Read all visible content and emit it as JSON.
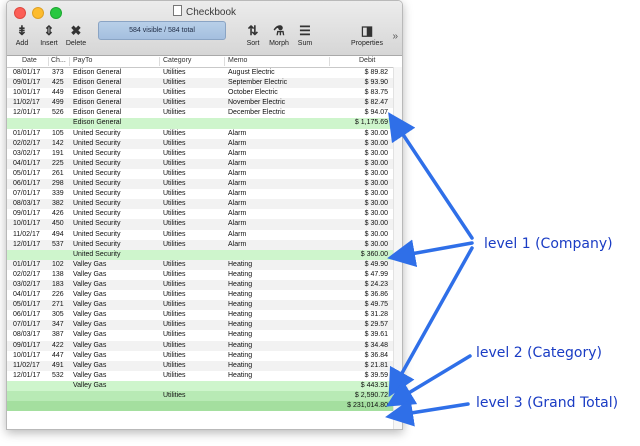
{
  "window": {
    "title": "Checkbook"
  },
  "toolbar": {
    "add": "Add",
    "insert": "Insert",
    "delete": "Delete",
    "status": "584 visible / 584 total",
    "sort": "Sort",
    "morph": "Morph",
    "sum": "Sum",
    "properties": "Properties"
  },
  "columns": {
    "date": "Date",
    "check": "Ch...",
    "payto": "PayTo",
    "category": "Category",
    "memo": "Memo",
    "debit": "Debit"
  },
  "rows": [
    {
      "type": "data",
      "date": "08/01/17",
      "check": "373",
      "payto": "Edison General",
      "category": "Utilities",
      "memo": "August Electric",
      "debit": "$ 89.82"
    },
    {
      "type": "data",
      "date": "09/01/17",
      "check": "425",
      "payto": "Edison General",
      "category": "Utilities",
      "memo": "September Electric",
      "debit": "$ 93.90"
    },
    {
      "type": "data",
      "date": "10/01/17",
      "check": "449",
      "payto": "Edison General",
      "category": "Utilities",
      "memo": "October Electric",
      "debit": "$ 83.75"
    },
    {
      "type": "data",
      "date": "11/02/17",
      "check": "499",
      "payto": "Edison General",
      "category": "Utilities",
      "memo": "November Electric",
      "debit": "$ 82.47"
    },
    {
      "type": "data",
      "date": "12/01/17",
      "check": "526",
      "payto": "Edison General",
      "category": "Utilities",
      "memo": "December Electric",
      "debit": "$ 94.07"
    },
    {
      "type": "sub",
      "date": "",
      "check": "",
      "payto": "Edison General",
      "category": "",
      "memo": "",
      "debit": "$ 1,175.69"
    },
    {
      "type": "data",
      "date": "01/01/17",
      "check": "105",
      "payto": "United Security",
      "category": "Utilities",
      "memo": "Alarm",
      "debit": "$ 30.00"
    },
    {
      "type": "data",
      "date": "02/02/17",
      "check": "142",
      "payto": "United Security",
      "category": "Utilities",
      "memo": "Alarm",
      "debit": "$ 30.00"
    },
    {
      "type": "data",
      "date": "03/02/17",
      "check": "191",
      "payto": "United Security",
      "category": "Utilities",
      "memo": "Alarm",
      "debit": "$ 30.00"
    },
    {
      "type": "data",
      "date": "04/01/17",
      "check": "225",
      "payto": "United Security",
      "category": "Utilities",
      "memo": "Alarm",
      "debit": "$ 30.00"
    },
    {
      "type": "data",
      "date": "05/01/17",
      "check": "261",
      "payto": "United Security",
      "category": "Utilities",
      "memo": "Alarm",
      "debit": "$ 30.00"
    },
    {
      "type": "data",
      "date": "06/01/17",
      "check": "298",
      "payto": "United Security",
      "category": "Utilities",
      "memo": "Alarm",
      "debit": "$ 30.00"
    },
    {
      "type": "data",
      "date": "07/01/17",
      "check": "339",
      "payto": "United Security",
      "category": "Utilities",
      "memo": "Alarm",
      "debit": "$ 30.00"
    },
    {
      "type": "data",
      "date": "08/03/17",
      "check": "382",
      "payto": "United Security",
      "category": "Utilities",
      "memo": "Alarm",
      "debit": "$ 30.00"
    },
    {
      "type": "data",
      "date": "09/01/17",
      "check": "426",
      "payto": "United Security",
      "category": "Utilities",
      "memo": "Alarm",
      "debit": "$ 30.00"
    },
    {
      "type": "data",
      "date": "10/01/17",
      "check": "450",
      "payto": "United Security",
      "category": "Utilities",
      "memo": "Alarm",
      "debit": "$ 30.00"
    },
    {
      "type": "data",
      "date": "11/02/17",
      "check": "494",
      "payto": "United Security",
      "category": "Utilities",
      "memo": "Alarm",
      "debit": "$ 30.00"
    },
    {
      "type": "data",
      "date": "12/01/17",
      "check": "537",
      "payto": "United Security",
      "category": "Utilities",
      "memo": "Alarm",
      "debit": "$ 30.00"
    },
    {
      "type": "sub",
      "date": "",
      "check": "",
      "payto": "United Security",
      "category": "",
      "memo": "",
      "debit": "$ 360.00"
    },
    {
      "type": "data",
      "date": "01/01/17",
      "check": "102",
      "payto": "Valley Gas",
      "category": "Utilities",
      "memo": "Heating",
      "debit": "$ 49.90"
    },
    {
      "type": "data",
      "date": "02/02/17",
      "check": "138",
      "payto": "Valley Gas",
      "category": "Utilities",
      "memo": "Heating",
      "debit": "$ 47.99"
    },
    {
      "type": "data",
      "date": "03/02/17",
      "check": "183",
      "payto": "Valley Gas",
      "category": "Utilities",
      "memo": "Heating",
      "debit": "$ 24.23"
    },
    {
      "type": "data",
      "date": "04/01/17",
      "check": "226",
      "payto": "Valley Gas",
      "category": "Utilities",
      "memo": "Heating",
      "debit": "$ 36.86"
    },
    {
      "type": "data",
      "date": "05/01/17",
      "check": "271",
      "payto": "Valley Gas",
      "category": "Utilities",
      "memo": "Heating",
      "debit": "$ 49.75"
    },
    {
      "type": "data",
      "date": "06/01/17",
      "check": "305",
      "payto": "Valley Gas",
      "category": "Utilities",
      "memo": "Heating",
      "debit": "$ 31.28"
    },
    {
      "type": "data",
      "date": "07/01/17",
      "check": "347",
      "payto": "Valley Gas",
      "category": "Utilities",
      "memo": "Heating",
      "debit": "$ 29.57"
    },
    {
      "type": "data",
      "date": "08/03/17",
      "check": "387",
      "payto": "Valley Gas",
      "category": "Utilities",
      "memo": "Heating",
      "debit": "$ 39.61"
    },
    {
      "type": "data",
      "date": "09/01/17",
      "check": "422",
      "payto": "Valley Gas",
      "category": "Utilities",
      "memo": "Heating",
      "debit": "$ 34.48"
    },
    {
      "type": "data",
      "date": "10/01/17",
      "check": "447",
      "payto": "Valley Gas",
      "category": "Utilities",
      "memo": "Heating",
      "debit": "$ 36.84"
    },
    {
      "type": "data",
      "date": "11/02/17",
      "check": "491",
      "payto": "Valley Gas",
      "category": "Utilities",
      "memo": "Heating",
      "debit": "$ 21.81"
    },
    {
      "type": "data",
      "date": "12/01/17",
      "check": "532",
      "payto": "Valley Gas",
      "category": "Utilities",
      "memo": "Heating",
      "debit": "$ 39.59"
    },
    {
      "type": "sub",
      "date": "",
      "check": "",
      "payto": "Valley Gas",
      "category": "",
      "memo": "",
      "debit": "$ 443.91"
    },
    {
      "type": "sub2",
      "date": "",
      "check": "",
      "payto": "",
      "category": "Utilities",
      "memo": "",
      "debit": "$ 2,590.72"
    },
    {
      "type": "gt",
      "date": "",
      "check": "",
      "payto": "",
      "category": "",
      "memo": "",
      "debit": "$ 231,014.80"
    }
  ],
  "annotations": {
    "level1": "level 1 (Company)",
    "level2": "level 2 (Category)",
    "level3": "level 3 (Grand Total)"
  },
  "colors": {
    "arrow": "#2f6fe8",
    "subtotal": "#cef5cc",
    "grand_total": "#a4df9f"
  }
}
